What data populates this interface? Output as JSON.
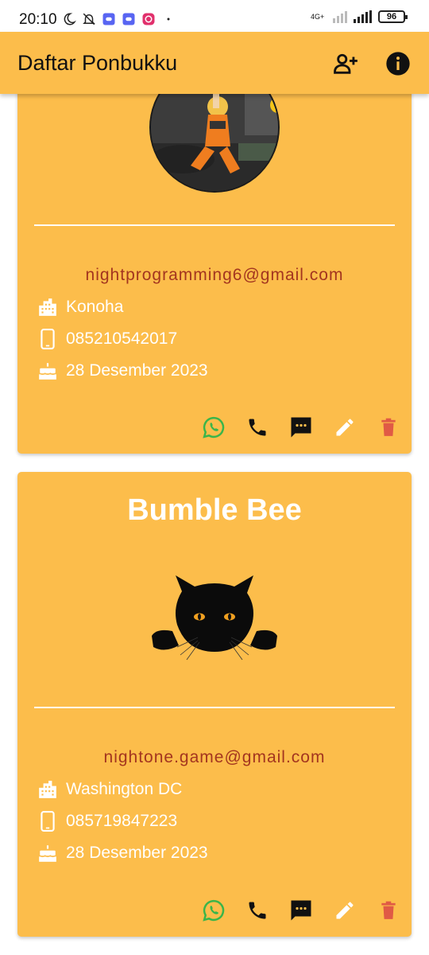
{
  "status_bar": {
    "time": "20:10",
    "network": "4G+",
    "battery": "96"
  },
  "app_bar": {
    "title": "Daftar Ponbukku",
    "actions": [
      "add-contact-icon",
      "info-icon"
    ]
  },
  "contacts": [
    {
      "name": "",
      "email": "nightprogramming6@gmail.com",
      "city": "Konoha",
      "phone": "085210542017",
      "birthday": "28 Desember 2023"
    },
    {
      "name": "Bumble Bee",
      "email": "nightone.game@gmail.com",
      "city": "Washington DC",
      "phone": "085719847223",
      "birthday": "28 Desember 2023"
    }
  ],
  "action_icons": [
    "whatsapp-icon",
    "phone-icon",
    "message-icon",
    "edit-icon",
    "delete-icon"
  ],
  "colors": {
    "card": "#fcbd4b",
    "email": "#a3351f",
    "whatsapp": "#3bb54a",
    "delete": "#e05a45"
  }
}
